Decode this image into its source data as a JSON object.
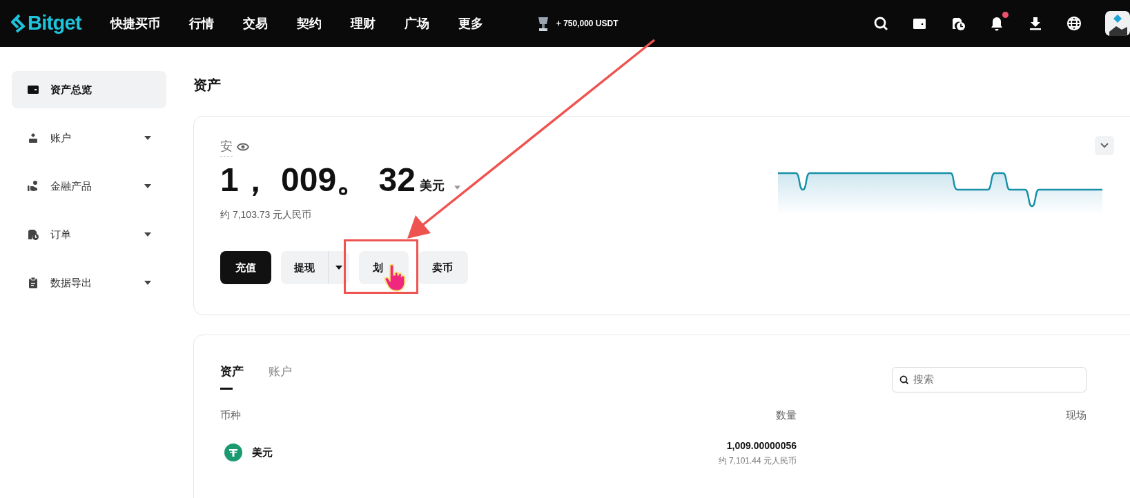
{
  "nav": {
    "logo": "Bitget",
    "items": [
      "快捷买币",
      "行情",
      "交易",
      "契约",
      "理财",
      "广场",
      "更多"
    ],
    "promo": "+ 750,000 USDT",
    "has_notification": true
  },
  "sidebar": {
    "items": [
      {
        "label": "资产总览",
        "selected": true,
        "expandable": false
      },
      {
        "label": "账户",
        "selected": false,
        "expandable": true
      },
      {
        "label": "金融产品",
        "selected": false,
        "expandable": true
      },
      {
        "label": "订单",
        "selected": false,
        "expandable": true
      },
      {
        "label": "数据导出",
        "selected": false,
        "expandable": true
      }
    ]
  },
  "page_title": "资产",
  "balance": {
    "label": "安",
    "amount": "1， 009。 32",
    "currency": "美元",
    "approx": "约 7,103.73 元人民币",
    "buttons": [
      {
        "label": "充值",
        "kind": "primary"
      },
      {
        "label": "提现",
        "kind": "split"
      },
      {
        "label": "划",
        "kind": "secondary"
      },
      {
        "label": "卖币",
        "kind": "secondary"
      }
    ]
  },
  "assets": {
    "tabs": [
      {
        "label": "资产",
        "selected": true
      },
      {
        "label": "账户",
        "selected": false
      }
    ],
    "search": {
      "placeholder": "搜索"
    },
    "columns": [
      "币种",
      "数量",
      "现场"
    ],
    "rows": [
      {
        "coin": "美元",
        "amount": "1,009.00000056",
        "approx": "约 7,101.44 元人民币"
      }
    ]
  }
}
